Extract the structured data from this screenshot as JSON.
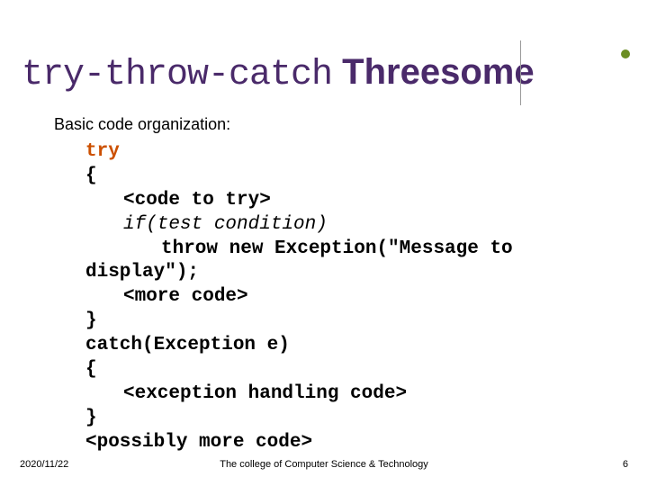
{
  "title": {
    "mono": "try-throw-catch",
    "sans": " Threesome"
  },
  "subhead": "Basic code organization:",
  "code": {
    "l1": "try",
    "l2": "{",
    "l3": "<code to try>",
    "l4": "if(test condition)",
    "l5": "throw new Exception(\"Message to",
    "l5b": "display\");",
    "l6": "<more code>",
    "l7": "}",
    "l8": "catch(Exception e)",
    "l9": "{",
    "l10": "<exception handling code>",
    "l11": "}",
    "l12": "<possibly more code>"
  },
  "footer": {
    "date": "2020/11/22",
    "center": "The college of Computer Science & Technology",
    "page": "6"
  }
}
